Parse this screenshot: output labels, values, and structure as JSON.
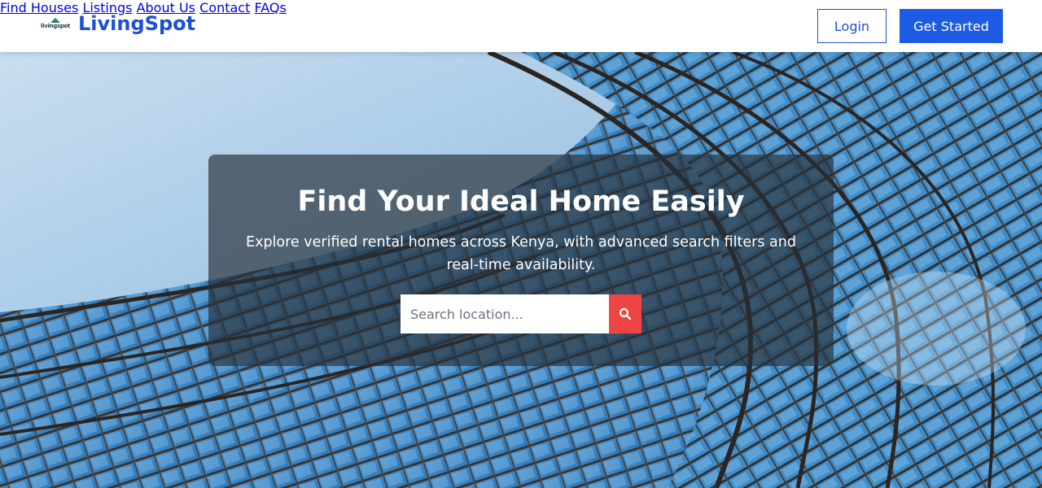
{
  "brand": {
    "logo_text": "livingspot",
    "name": "LivingSpot"
  },
  "nav": {
    "items": [
      {
        "label": "Find Houses"
      },
      {
        "label": "Listings"
      },
      {
        "label": "About Us"
      },
      {
        "label": "Contact"
      },
      {
        "label": "FAQs"
      }
    ],
    "login_label": "Login",
    "get_started_label": "Get Started"
  },
  "hero": {
    "title": "Find Your Ideal Home Easily",
    "subtitle": "Explore verified rental homes across Kenya, with advanced search filters and real-time availability.",
    "search_placeholder": "Search location...",
    "search_icon": "search-icon"
  },
  "colors": {
    "brand": "#1d4ed8",
    "primary_button": "#1d5be3",
    "search_button": "#ef4444"
  }
}
